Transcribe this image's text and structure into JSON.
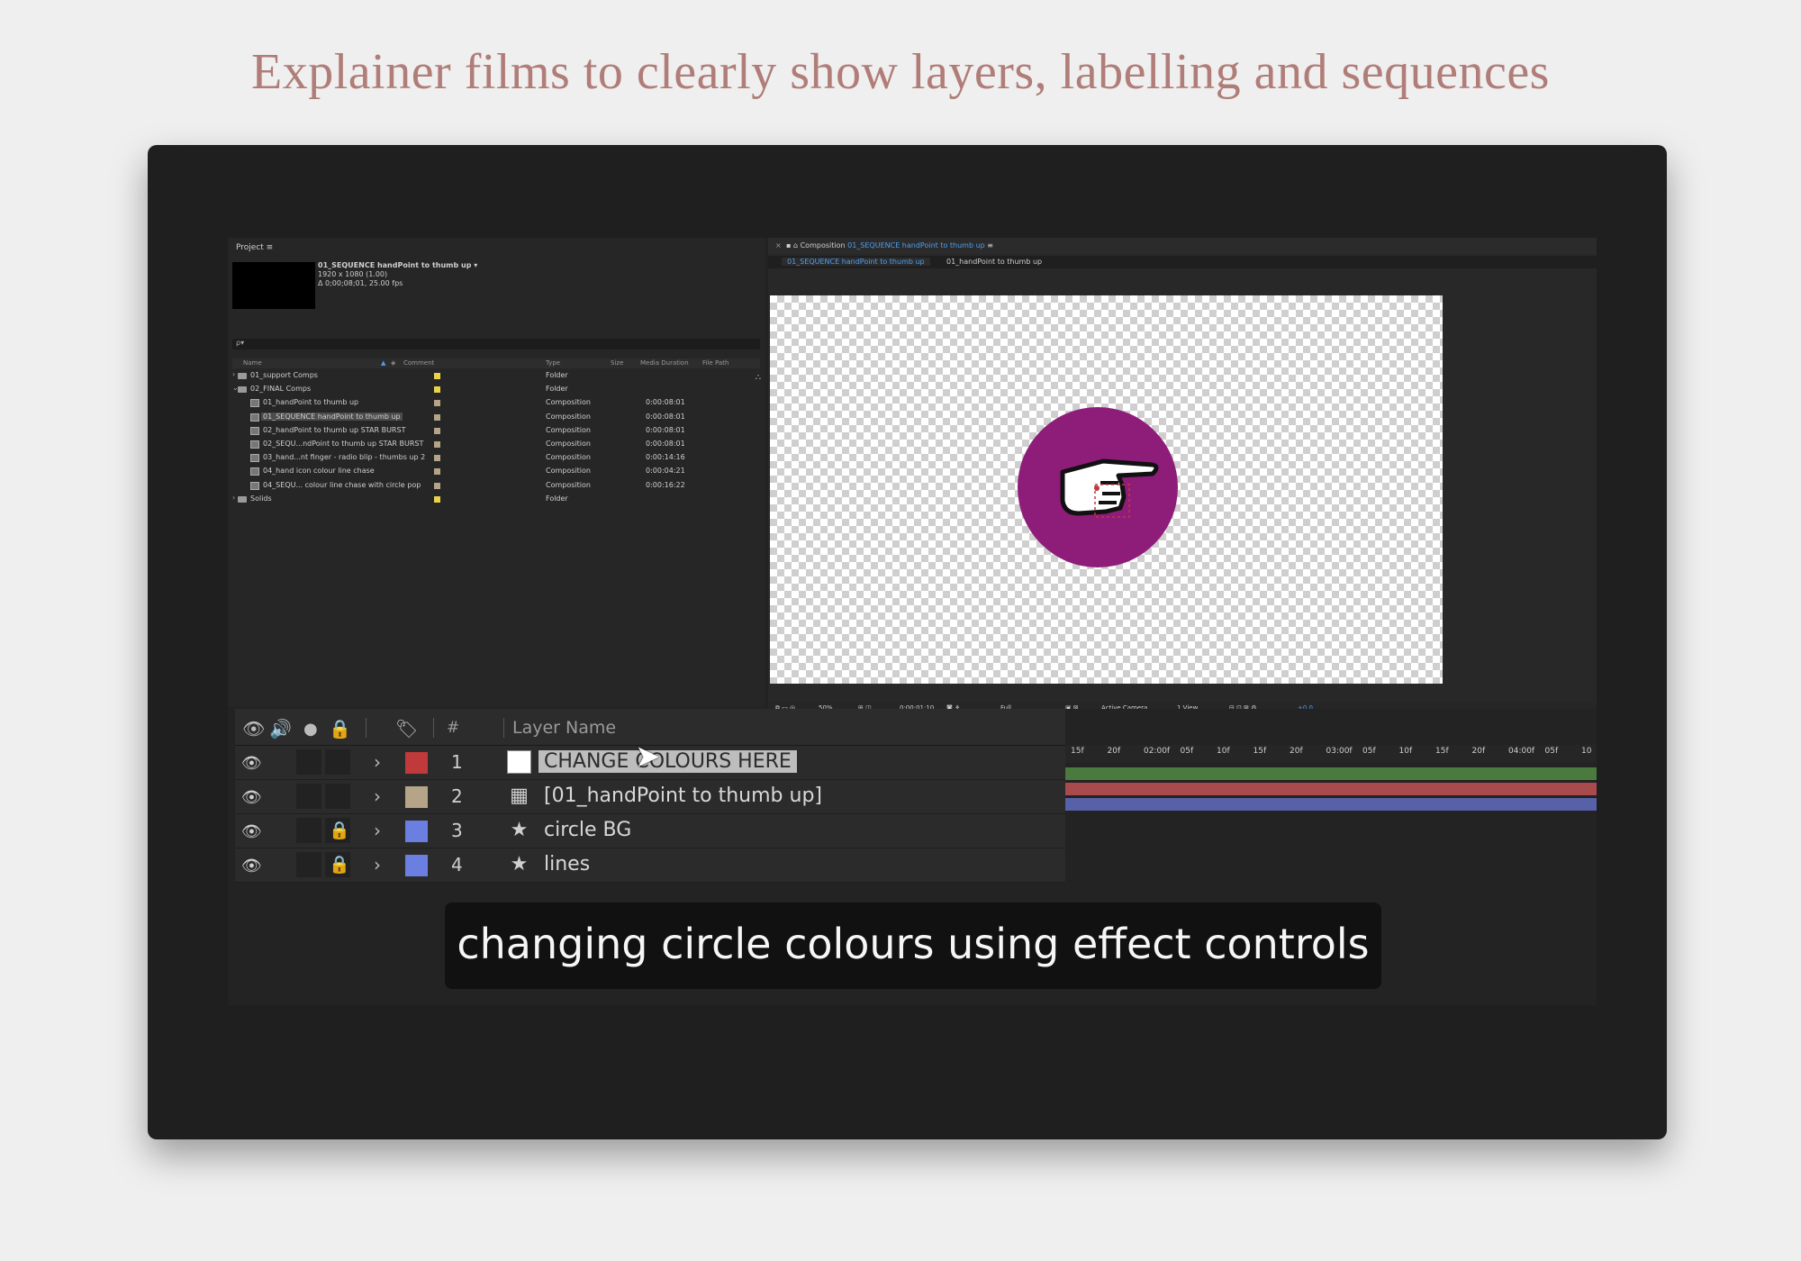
{
  "headline": "Explainer films to clearly show layers, labelling and sequences",
  "project": {
    "tab": "Project ≡",
    "comp_title": "01_SEQUENCE handPoint to thumb up ▾",
    "comp_res": "1920 x 1080 (1.00)",
    "comp_dur": "Δ 0;00;08;01, 25.00 fps",
    "search_icon": "ρ▾",
    "columns": {
      "name": "Name",
      "comment": "Comment",
      "type": "Type",
      "size": "Size",
      "media_duration": "Media Duration",
      "file_path": "File Path"
    },
    "items": [
      {
        "arrow": "›",
        "kind": "folder",
        "indent": 0,
        "name": "01_support Comps",
        "label_color": "#e8d24a",
        "type": "Folder",
        "duration": ""
      },
      {
        "arrow": "⌄",
        "kind": "folder",
        "indent": 0,
        "name": "02_FINAL Comps",
        "label_color": "#e8d24a",
        "type": "Folder",
        "duration": ""
      },
      {
        "arrow": "",
        "kind": "comp",
        "indent": 1,
        "name": "01_handPoint to thumb up",
        "label_color": "#b5a487",
        "type": "Composition",
        "duration": "0:00:08:01"
      },
      {
        "arrow": "",
        "kind": "comp",
        "indent": 1,
        "name": "01_SEQUENCE handPoint to thumb up",
        "label_color": "#b5a487",
        "type": "Composition",
        "duration": "0:00:08:01",
        "selected": true
      },
      {
        "arrow": "",
        "kind": "comp",
        "indent": 1,
        "name": "02_handPoint to thumb up STAR BURST",
        "label_color": "#b5a487",
        "type": "Composition",
        "duration": "0:00:08:01"
      },
      {
        "arrow": "",
        "kind": "comp",
        "indent": 1,
        "name": "02_SEQU...ndPoint to thumb up STAR BURST",
        "label_color": "#b5a487",
        "type": "Composition",
        "duration": "0:00:08:01"
      },
      {
        "arrow": "",
        "kind": "comp",
        "indent": 1,
        "name": "03_hand...nt finger - radio blip - thumbs up 2",
        "label_color": "#b5a487",
        "type": "Composition",
        "duration": "0:00:14:16"
      },
      {
        "arrow": "",
        "kind": "comp",
        "indent": 1,
        "name": "04_hand icon colour line chase",
        "label_color": "#b5a487",
        "type": "Composition",
        "duration": "0:00:04:21"
      },
      {
        "arrow": "",
        "kind": "comp",
        "indent": 1,
        "name": "04_SEQU... colour line chase with circle pop",
        "label_color": "#b5a487",
        "type": "Composition",
        "duration": "0:00:16:22"
      },
      {
        "arrow": "›",
        "kind": "folder",
        "indent": 0,
        "name": "Solids",
        "label_color": "#e8d24a",
        "type": "Folder",
        "duration": ""
      }
    ]
  },
  "composition": {
    "close": "×",
    "tab_prefix": "Composition",
    "tab_name": "01_SEQUENCE handPoint to thumb up",
    "tab_menu": "≡",
    "breadcrumb_active": "01_SEQUENCE handPoint to thumb up",
    "breadcrumb_next": "01_handPoint to thumb up",
    "circle_color": "#8e1d7a",
    "viewer": {
      "zoom": "50%",
      "timecode": "0:00:01:10",
      "resolution": "Full",
      "camera": "Active Camera",
      "views": "1 View",
      "exposure": "+0.0"
    }
  },
  "timeline": {
    "header": {
      "hash": "#",
      "layer_name": "Layer Name"
    },
    "ruler": [
      "15f",
      "20f",
      "02:00f",
      "05f",
      "10f",
      "15f",
      "20f",
      "03:00f",
      "05f",
      "10f",
      "15f",
      "20f",
      "04:00f",
      "05f",
      "10"
    ],
    "layers": [
      {
        "num": "1",
        "name": "CHANGE COLOURS HERE",
        "color": "#c0393b",
        "type": "solid",
        "locked": false,
        "selected": true
      },
      {
        "num": "2",
        "name": "[01_handPoint to thumb up]",
        "color": "#b5a487",
        "type": "comp",
        "locked": false
      },
      {
        "num": "3",
        "name": "circle BG",
        "color": "#6b7fe0",
        "type": "shape",
        "locked": true
      },
      {
        "num": "4",
        "name": "lines",
        "color": "#6b7fe0",
        "type": "shape",
        "locked": true
      }
    ],
    "bars": [
      {
        "color": "#4a7a3e"
      },
      {
        "color": "#a94a4d"
      },
      {
        "color": "#5661a8"
      }
    ]
  },
  "caption": "changing circle colours using effect controls"
}
